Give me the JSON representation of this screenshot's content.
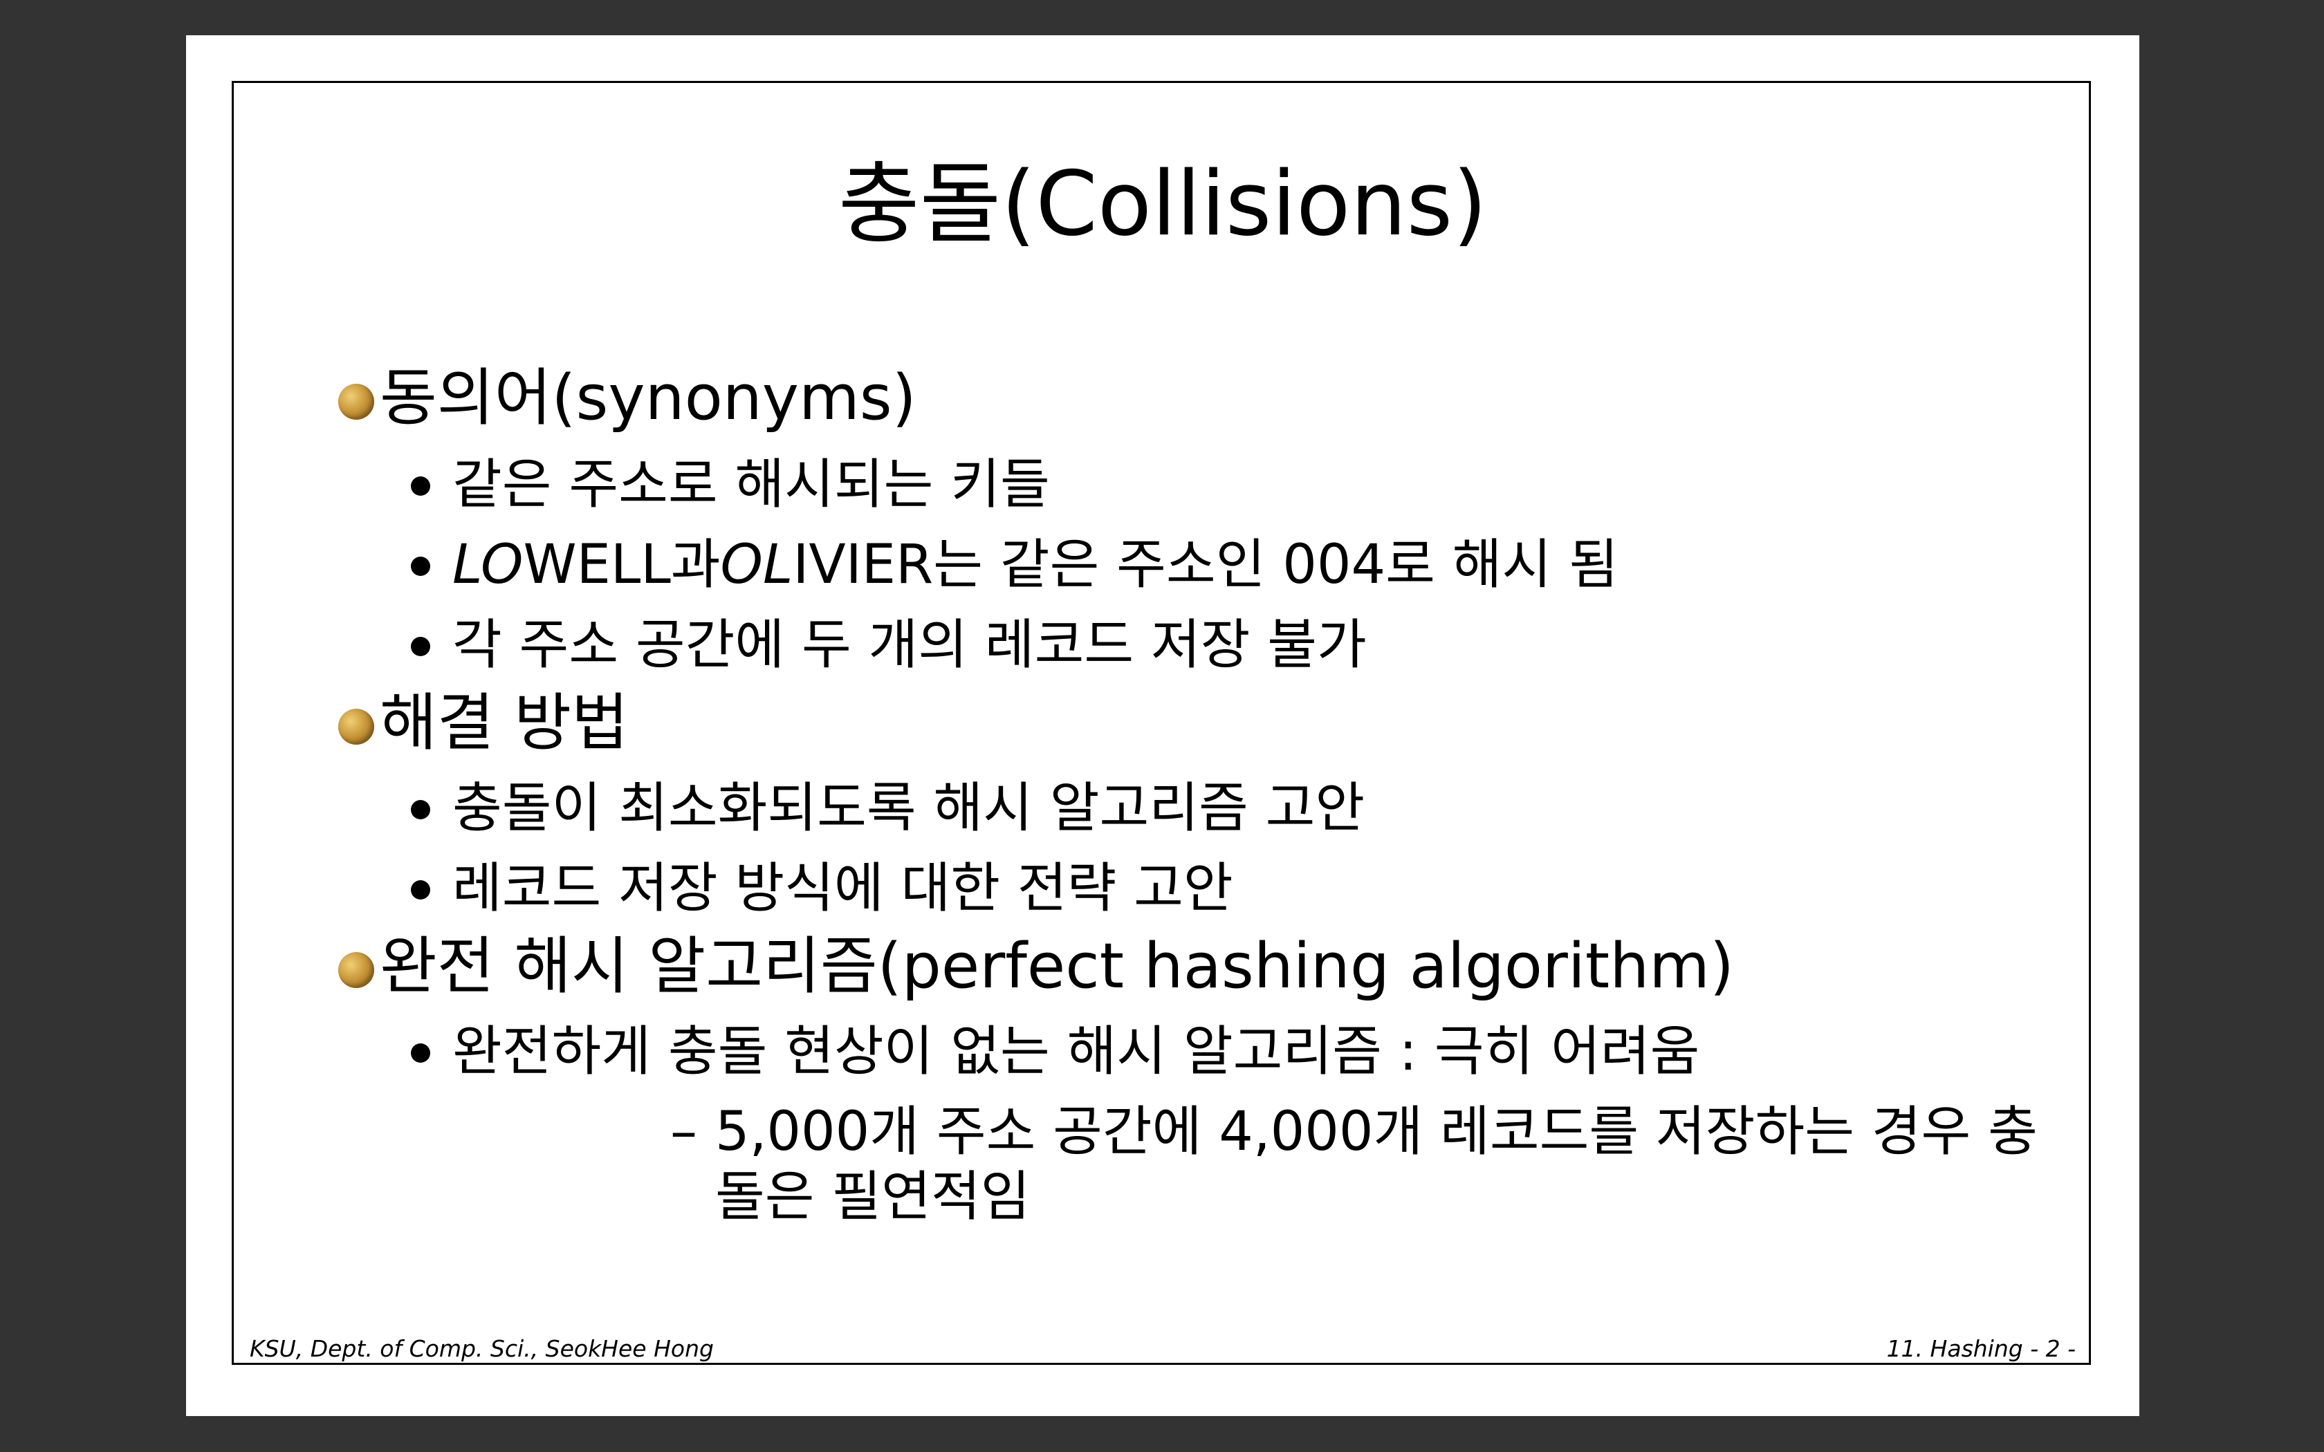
{
  "slide": {
    "title": "충돌(Collisions)",
    "sections": [
      {
        "heading": "동의어(synonyms)",
        "items": [
          "같은 주소로 해시되는 키들",
          {
            "parts": [
              {
                "text": "LO",
                "italic": true
              },
              {
                "text": "WELL과",
                "italic": false
              },
              {
                "text": "OL",
                "italic": true
              },
              {
                "text": "IVIER는 같은 주소인 004로 해시 됨",
                "italic": false
              }
            ]
          },
          "각 주소 공간에 두 개의 레코드 저장 불가"
        ]
      },
      {
        "heading": "해결 방법",
        "items": [
          "충돌이 최소화되도록 해시 알고리즘 고안",
          "레코드 저장 방식에 대한 전략 고안"
        ]
      },
      {
        "heading": "완전 해시 알고리즘(perfect hashing algorithm)",
        "items": [
          "완전하게 충돌 현상이 없는 해시 알고리즘 : 극히 어려움"
        ],
        "subitem": {
          "line1": "5,000개 주소 공간에 4,000개 레코드를 저장하는 경우 충",
          "line2": "돌은 필연적임"
        }
      }
    ]
  },
  "footer": {
    "left": "KSU, Dept. of Comp. Sci., SeokHee Hong",
    "right": "11. Hashing   - 2 -"
  }
}
